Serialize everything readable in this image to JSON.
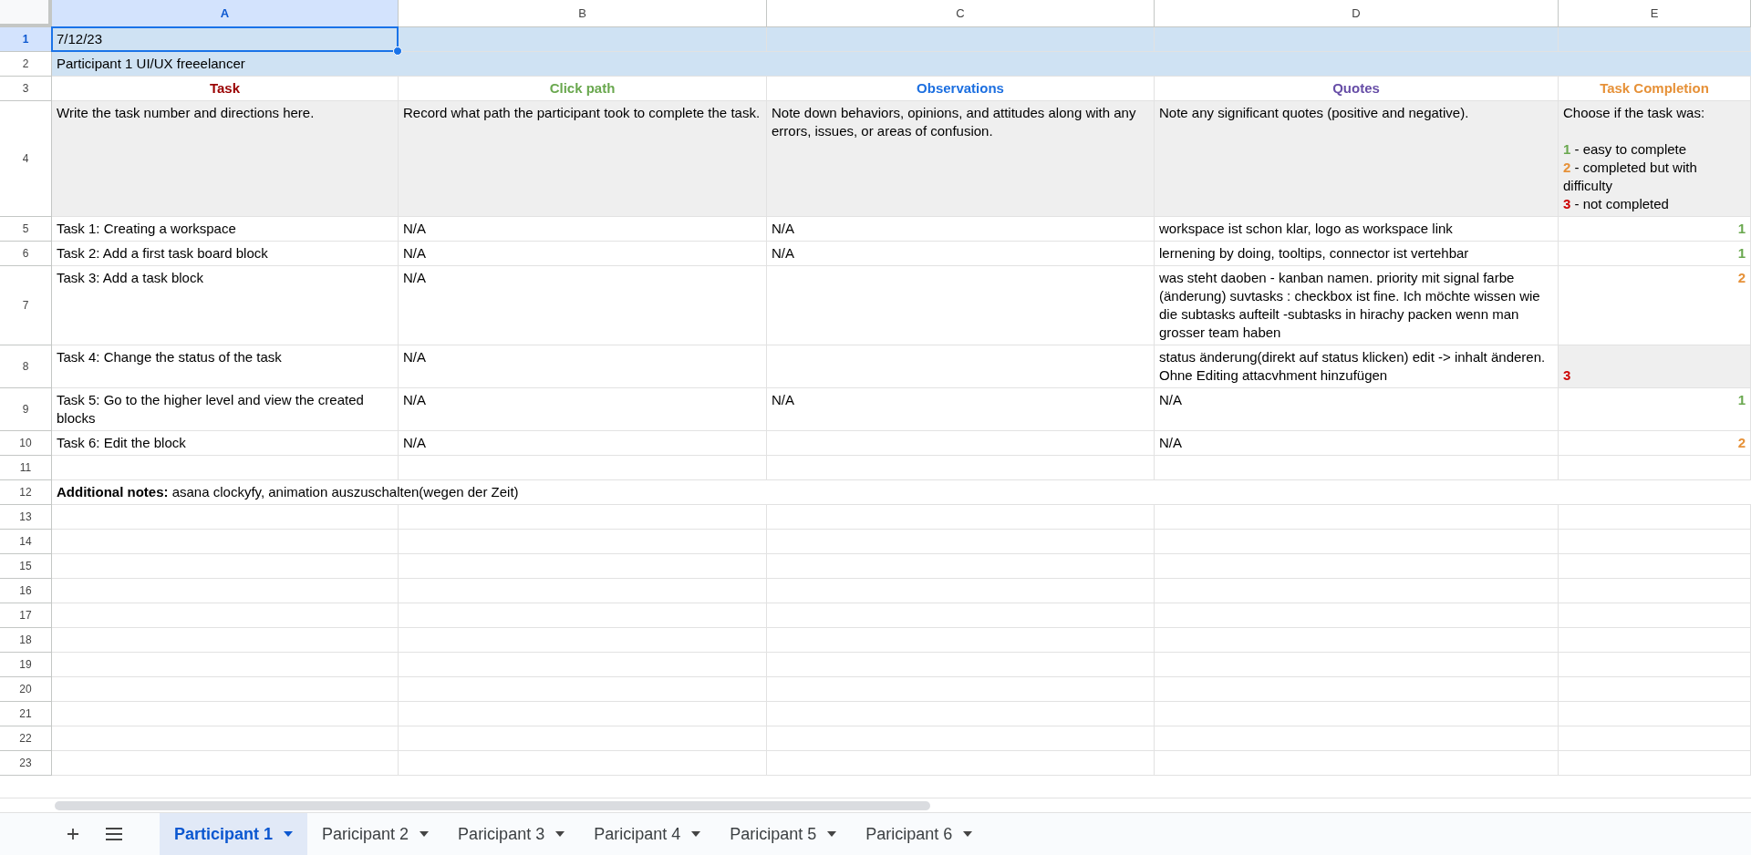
{
  "columns": [
    {
      "label": "A",
      "selected": true
    },
    {
      "label": "B",
      "selected": false
    },
    {
      "label": "C",
      "selected": false
    },
    {
      "label": "D",
      "selected": false
    },
    {
      "label": "E",
      "selected": false
    }
  ],
  "rows": [
    {
      "number": "1",
      "selected": true,
      "kind": "cells",
      "highlighted": true,
      "shaded": false,
      "cells": [
        {
          "kind": "text",
          "text": "7/12/23"
        },
        {
          "kind": "empty"
        },
        {
          "kind": "empty"
        },
        {
          "kind": "empty"
        },
        {
          "kind": "empty"
        }
      ]
    },
    {
      "number": "2",
      "selected": false,
      "kind": "wide",
      "highlighted": true,
      "shaded": false,
      "text": "Participant 1 UI/UX freeelancer"
    },
    {
      "number": "3",
      "selected": false,
      "kind": "cells",
      "highlighted": false,
      "shaded": false,
      "cells": [
        {
          "kind": "header",
          "text": "Task",
          "color": "#990000"
        },
        {
          "kind": "header",
          "text": "Click path",
          "color": "#6aa84f"
        },
        {
          "kind": "header",
          "text": "Observations",
          "color": "#1c6fe0"
        },
        {
          "kind": "header",
          "text": "Quotes",
          "color": "#674ea7"
        },
        {
          "kind": "header",
          "text": "Task Completion",
          "color": "#e69138"
        }
      ]
    },
    {
      "number": "4",
      "selected": false,
      "kind": "cells",
      "highlighted": false,
      "shaded": true,
      "cells": [
        {
          "kind": "text",
          "text": "Write the task number and directions here."
        },
        {
          "kind": "text",
          "text": "Record what path the participant took to complete the task."
        },
        {
          "kind": "text",
          "text": "Note down behaviors, opinions, and attitudes along with any errors, issues, or areas of confusion."
        },
        {
          "kind": "text",
          "text": "Note any significant quotes (positive and negative)."
        },
        {
          "kind": "legend",
          "intro": "Choose if the task was:",
          "items": [
            {
              "number": "1",
              "color": "#6aa84f",
              "text": "- easy to complete"
            },
            {
              "number": "2",
              "color": "#e69138",
              "text": "- completed but with difficulty"
            },
            {
              "number": "3",
              "color": "#cc0000",
              "text": "- not completed"
            }
          ]
        }
      ]
    },
    {
      "number": "5",
      "selected": false,
      "kind": "cells",
      "highlighted": false,
      "shaded": false,
      "cells": [
        {
          "kind": "text",
          "text": "Task 1: Creating a workspace"
        },
        {
          "kind": "text",
          "text": "N/A"
        },
        {
          "kind": "text",
          "text": "N/A"
        },
        {
          "kind": "text",
          "text": "workspace ist schon klar, logo as workspace link"
        },
        {
          "kind": "score",
          "text": "1",
          "color": "#6aa84f",
          "shaded": false
        }
      ]
    },
    {
      "number": "6",
      "selected": false,
      "kind": "cells",
      "highlighted": false,
      "shaded": false,
      "cells": [
        {
          "kind": "text",
          "text": "Task 2: Add a first task board block"
        },
        {
          "kind": "text",
          "text": "N/A"
        },
        {
          "kind": "text",
          "text": "N/A"
        },
        {
          "kind": "text",
          "text": "lernening by doing, tooltips, connector ist vertehbar"
        },
        {
          "kind": "score",
          "text": "1",
          "color": "#6aa84f",
          "shaded": false
        }
      ]
    },
    {
      "number": "7",
      "selected": false,
      "kind": "cells",
      "highlighted": false,
      "shaded": false,
      "cells": [
        {
          "kind": "text",
          "text": "Task 3: Add a task block"
        },
        {
          "kind": "text",
          "text": "N/A"
        },
        {
          "kind": "empty"
        },
        {
          "kind": "text",
          "text": "was steht daoben - kanban namen. priority mit signal farbe (änderung) suvtasks :  checkbox ist fine. Ich möchte wissen wie die subtasks aufteilt -subtasks in hirachy packen wenn man grosser team haben"
        },
        {
          "kind": "score",
          "text": "2",
          "color": "#e69138",
          "shaded": false
        }
      ]
    },
    {
      "number": "8",
      "selected": false,
      "kind": "cells",
      "highlighted": false,
      "shaded": false,
      "cells": [
        {
          "kind": "text",
          "text": "Task 4: Change the status of the task"
        },
        {
          "kind": "text",
          "text": "N/A"
        },
        {
          "kind": "empty"
        },
        {
          "kind": "text",
          "text": "status änderung(direkt auf status klicken) edit -> inhalt änderen. Ohne Editing attacvhment hinzufügen"
        },
        {
          "kind": "score_corner",
          "text": "3",
          "color": "#cc0000",
          "shaded": true
        }
      ]
    },
    {
      "number": "9",
      "selected": false,
      "kind": "cells",
      "highlighted": false,
      "shaded": false,
      "cells": [
        {
          "kind": "text",
          "text": "Task 5: Go to the higher level and view the created blocks"
        },
        {
          "kind": "text",
          "text": "N/A"
        },
        {
          "kind": "text",
          "text": "N/A"
        },
        {
          "kind": "text",
          "text": "N/A"
        },
        {
          "kind": "score",
          "text": "1",
          "color": "#6aa84f",
          "shaded": false
        }
      ]
    },
    {
      "number": "10",
      "selected": false,
      "kind": "cells",
      "highlighted": false,
      "shaded": false,
      "cells": [
        {
          "kind": "text",
          "text": "Task 6: Edit the block"
        },
        {
          "kind": "text",
          "text": "N/A"
        },
        {
          "kind": "empty"
        },
        {
          "kind": "text",
          "text": "N/A"
        },
        {
          "kind": "score",
          "text": "2",
          "color": "#e69138",
          "shaded": false
        }
      ]
    },
    {
      "number": "11",
      "selected": false,
      "kind": "cells",
      "highlighted": false,
      "shaded": false,
      "cells": [
        {
          "kind": "empty"
        },
        {
          "kind": "empty"
        },
        {
          "kind": "empty"
        },
        {
          "kind": "empty"
        },
        {
          "kind": "empty"
        }
      ]
    },
    {
      "number": "12",
      "selected": false,
      "kind": "wide",
      "highlighted": false,
      "shaded": false,
      "text": "**Additional notes:** asana clockyfy, animation auszuschalten(wegen der Zeit)"
    },
    {
      "number": "13",
      "selected": false,
      "kind": "cells",
      "highlighted": false,
      "shaded": false,
      "cells": []
    },
    {
      "number": "14",
      "selected": false,
      "kind": "cells",
      "highlighted": false,
      "shaded": false,
      "cells": []
    },
    {
      "number": "15",
      "selected": false,
      "kind": "cells",
      "highlighted": false,
      "shaded": false,
      "cells": []
    },
    {
      "number": "16",
      "selected": false,
      "kind": "cells",
      "highlighted": false,
      "shaded": false,
      "cells": []
    },
    {
      "number": "17",
      "selected": false,
      "kind": "cells",
      "highlighted": false,
      "shaded": false,
      "cells": []
    },
    {
      "number": "18",
      "selected": false,
      "kind": "cells",
      "highlighted": false,
      "shaded": false,
      "cells": []
    },
    {
      "number": "19",
      "selected": false,
      "kind": "cells",
      "highlighted": false,
      "shaded": false,
      "cells": []
    },
    {
      "number": "20",
      "selected": false,
      "kind": "cells",
      "highlighted": false,
      "shaded": false,
      "cells": []
    },
    {
      "number": "21",
      "selected": false,
      "kind": "cells",
      "highlighted": false,
      "shaded": false,
      "cells": []
    },
    {
      "number": "22",
      "selected": false,
      "kind": "cells",
      "highlighted": false,
      "shaded": false,
      "cells": []
    },
    {
      "number": "23",
      "selected": false,
      "kind": "cells",
      "highlighted": false,
      "shaded": false,
      "cells": []
    }
  ],
  "sheet_tabs": [
    {
      "label": "Participant 1",
      "selected": true
    },
    {
      "label": "Paricipant 2",
      "selected": false
    },
    {
      "label": "Paricipant 3",
      "selected": false
    },
    {
      "label": "Paricipant 4",
      "selected": false
    },
    {
      "label": "Paricipant 5",
      "selected": false
    },
    {
      "label": "Paricipant 6",
      "selected": false
    }
  ]
}
